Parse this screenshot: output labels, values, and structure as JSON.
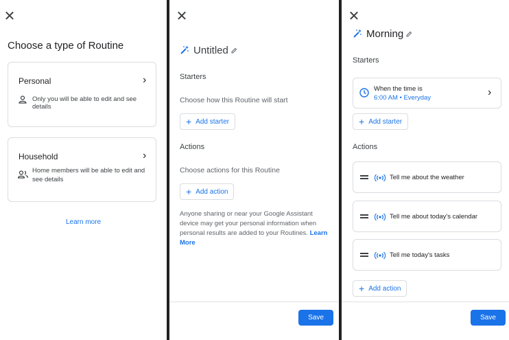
{
  "screen1": {
    "title": "Choose a type of Routine",
    "personal": {
      "title": "Personal",
      "desc": "Only you will be able to edit and see details"
    },
    "household": {
      "title": "Household",
      "desc": "Home members will be able to edit and see details"
    },
    "learn_more": "Learn more"
  },
  "screen2": {
    "title": "Untitled",
    "starters_heading": "Starters",
    "starters_hint": "Choose how this Routine will start",
    "add_starter": "Add starter",
    "actions_heading": "Actions",
    "actions_hint": "Choose actions for this Routine",
    "add_action": "Add action",
    "disclaimer": "Anyone sharing or near your Google Assistant device may get your personal information when personal results are added to your Routines.",
    "learn_more": "Learn More",
    "save": "Save"
  },
  "screen3": {
    "title": "Morning",
    "starters_heading": "Starters",
    "starter": {
      "title": "When the time is",
      "detail": "6:00 AM • Everyday"
    },
    "add_starter": "Add starter",
    "actions_heading": "Actions",
    "actions": [
      {
        "label": "Tell me about the weather"
      },
      {
        "label": "Tell me about today's calendar"
      },
      {
        "label": "Tell me today's tasks"
      }
    ],
    "add_action": "Add action",
    "save": "Save"
  },
  "colors": {
    "accent": "#1a73e8",
    "border": "#dadce0",
    "text": "#202124",
    "muted": "#5f6368"
  }
}
